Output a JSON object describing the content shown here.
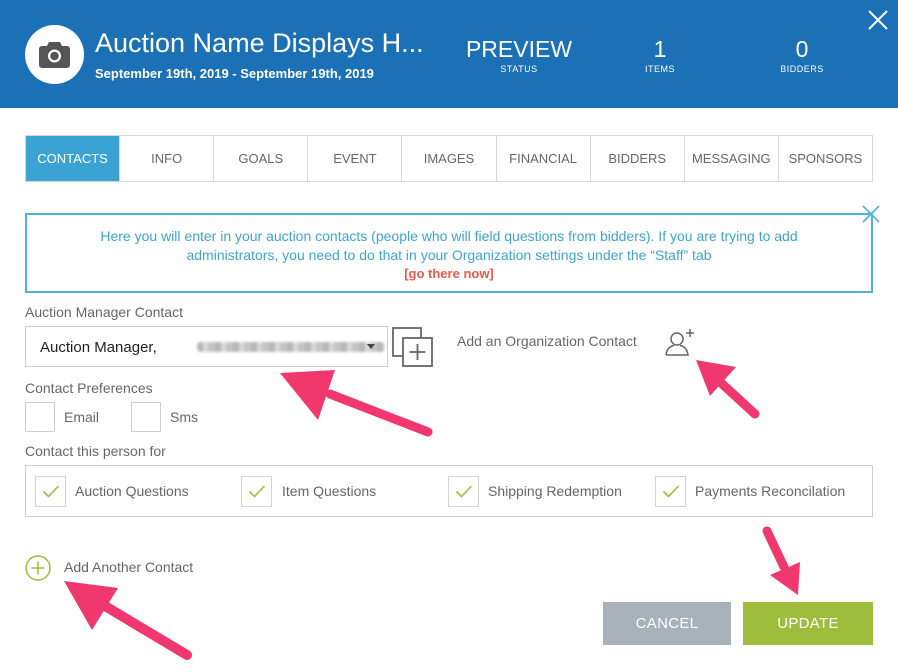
{
  "header": {
    "title": "Auction Name Displays H...",
    "dates": "September 19th, 2019 - September 19th, 2019",
    "stats": [
      {
        "value": "PREVIEW",
        "label": "STATUS"
      },
      {
        "value": "1",
        "label": "ITEMS"
      },
      {
        "value": "0",
        "label": "BIDDERS"
      }
    ],
    "avatar_icon": "camera-icon",
    "close_icon": "close-icon"
  },
  "tabs": [
    {
      "label": "CONTACTS",
      "active": true
    },
    {
      "label": "INFO",
      "active": false
    },
    {
      "label": "GOALS",
      "active": false
    },
    {
      "label": "EVENT",
      "active": false
    },
    {
      "label": "IMAGES",
      "active": false
    },
    {
      "label": "FINANCIAL",
      "active": false
    },
    {
      "label": "BIDDERS",
      "active": false
    },
    {
      "label": "MESSAGING",
      "active": false
    },
    {
      "label": "SPONSORS",
      "active": false
    }
  ],
  "info": {
    "message": "Here you will enter in your auction contacts (people who will field questions from bidders). If you are trying to add administrators, you need to do that in your Organization settings under the “Staff” tab",
    "link": "[go there now]"
  },
  "manager": {
    "label": "Auction Manager Contact",
    "selected_value": "Auction Manager,",
    "add_org_contact": "Add an Organization Contact"
  },
  "preferences": {
    "label": "Contact Preferences",
    "options": [
      {
        "label": "Email",
        "checked": false
      },
      {
        "label": "Sms",
        "checked": false
      }
    ]
  },
  "contact_for": {
    "label": "Contact this person for",
    "options": [
      {
        "label": "Auction Questions",
        "checked": true
      },
      {
        "label": "Item Questions",
        "checked": true
      },
      {
        "label": "Shipping Redemption",
        "checked": true
      },
      {
        "label": "Payments Reconcilation",
        "checked": true
      }
    ]
  },
  "add_another": "Add Another Contact",
  "buttons": {
    "cancel": "CANCEL",
    "update": "UPDATE"
  },
  "colors": {
    "header": "#1b70b6",
    "active_tab": "#3aa3d4",
    "info_text": "#3ea4d1",
    "link": "#e85a4a",
    "check": "#9ebd3c",
    "cancel": "#a7b2bb",
    "update": "#9ebd3c",
    "annotation_arrow": "#f0386f"
  }
}
